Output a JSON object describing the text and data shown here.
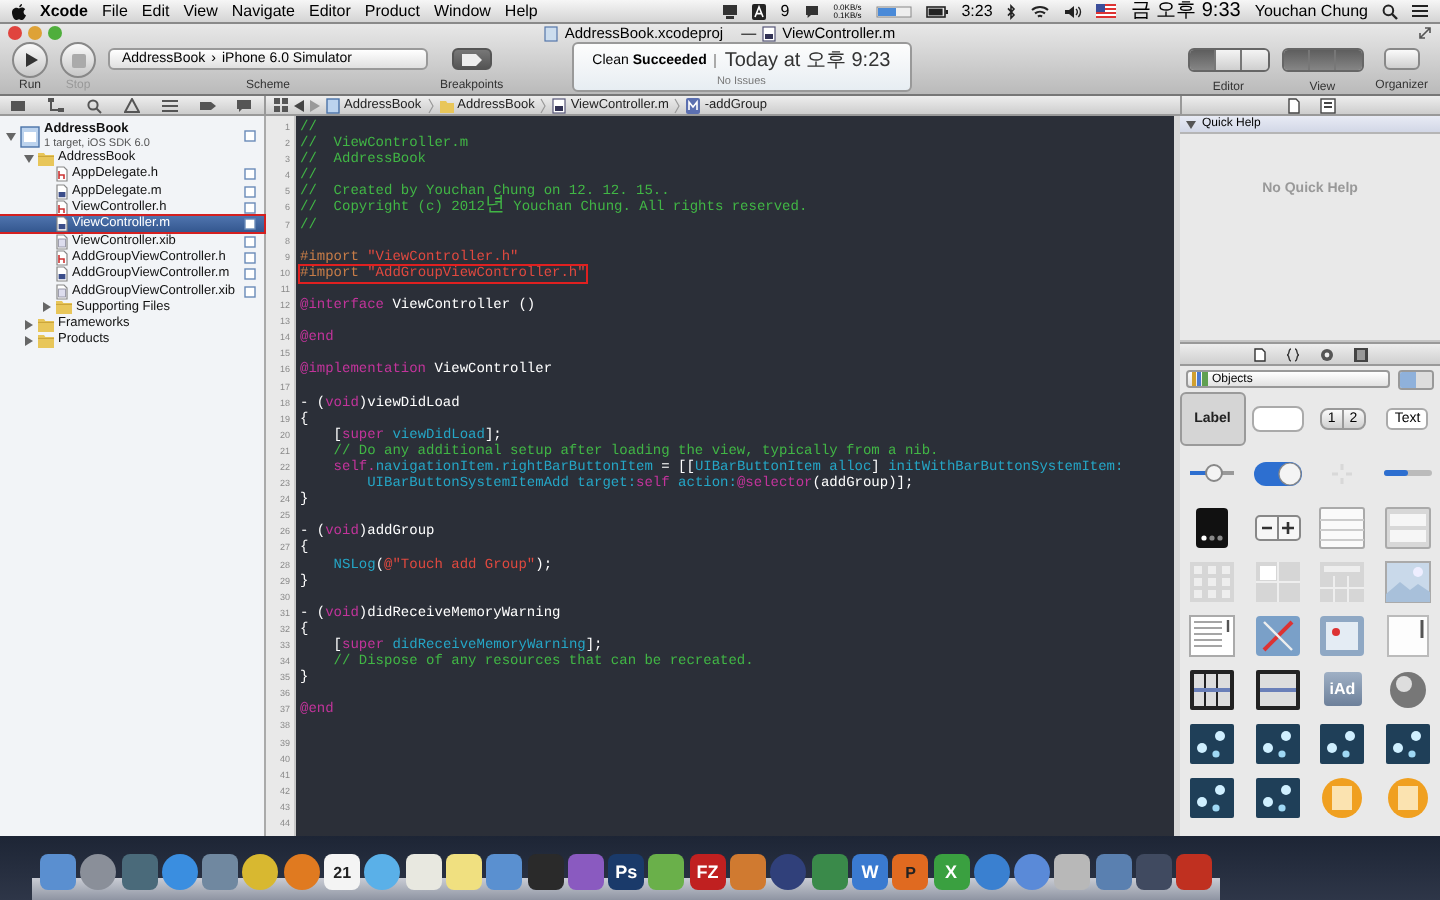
{
  "menu_bar": {
    "app": "Xcode",
    "menus": [
      "File",
      "Edit",
      "View",
      "Navigate",
      "Editor",
      "Product",
      "Window",
      "Help"
    ],
    "input_badge": "9",
    "network_up": "0.0KB/s",
    "network_down": "0.1KB/s",
    "battery": "3:23",
    "clock": "금 오후 9:33",
    "user": "Youchan Chung"
  },
  "window": {
    "project": "AddressBook.xcodeproj",
    "separator": "—",
    "file": "ViewController.m"
  },
  "toolbar": {
    "run": {
      "label": "Run",
      "disabled": false
    },
    "stop": {
      "label": "Stop",
      "disabled": true
    },
    "scheme": {
      "target": "AddressBook",
      "separator": "›",
      "destination": "iPhone 6.0 Simulator",
      "label": "Scheme"
    },
    "breakpoints": {
      "label": "Breakpoints"
    },
    "activity": {
      "status": "Clean **Succeeded**",
      "time": "Today at 오후 9:23",
      "issues": "No Issues"
    },
    "editor": {
      "label": "Editor",
      "segments": [
        {
          "selected": true
        },
        {
          "selected": false
        },
        {
          "selected": false
        }
      ]
    },
    "view": {
      "label": "View",
      "segments": [
        {
          "selected": true
        },
        {
          "selected": true
        },
        {
          "selected": true
        }
      ]
    },
    "organizer": {
      "label": "Organizer"
    }
  },
  "jump_bar": {
    "crumbs": [
      {
        "kind": "project",
        "text": "AddressBook"
      },
      {
        "kind": "folder",
        "text": "AddressBook"
      },
      {
        "kind": "source",
        "text": "ViewController.m"
      },
      {
        "kind": "method",
        "text": "-addGroup"
      }
    ]
  },
  "navigator": {
    "items": [
      {
        "kind": "project",
        "name": "AddressBook",
        "subtitle": "1 target, iOS SDK 6.0",
        "expanded": true,
        "selected": false,
        "annotated": false,
        "children": [
          {
            "kind": "group",
            "name": "AddressBook",
            "expanded": true,
            "selected": false,
            "annotated": false,
            "children": [
              {
                "kind": "header",
                "name": "AppDelegate.h",
                "selected": false,
                "annotated": false
              },
              {
                "kind": "source",
                "name": "AppDelegate.m",
                "selected": false,
                "annotated": false
              },
              {
                "kind": "header",
                "name": "ViewController.h",
                "selected": false,
                "annotated": false
              },
              {
                "kind": "source",
                "name": "ViewController.m",
                "selected": true,
                "annotated": true
              },
              {
                "kind": "xib",
                "name": "ViewController.xib",
                "selected": false,
                "annotated": false
              },
              {
                "kind": "header",
                "name": "AddGroupViewController.h",
                "selected": false,
                "annotated": false
              },
              {
                "kind": "source",
                "name": "AddGroupViewController.m",
                "selected": false,
                "annotated": false
              },
              {
                "kind": "xib",
                "name": "AddGroupViewController.xib",
                "selected": false,
                "annotated": false
              },
              {
                "kind": "group",
                "name": "Supporting Files",
                "expanded": false,
                "selected": false,
                "annotated": false
              }
            ]
          },
          {
            "kind": "group",
            "name": "Frameworks",
            "expanded": false,
            "selected": false,
            "annotated": false
          },
          {
            "kind": "group",
            "name": "Products",
            "expanded": false,
            "selected": false,
            "annotated": false
          }
        ]
      }
    ]
  },
  "editor": {
    "line_numbers": [
      "1",
      "2",
      "3",
      "4",
      "5",
      "6",
      "7",
      "8",
      "9",
      "10",
      "11",
      "12",
      "13",
      "14",
      "15",
      "16",
      "17",
      "18",
      "19",
      "20",
      "21",
      "22",
      "23",
      "24",
      "25",
      "26",
      "27",
      "28",
      "29",
      "30",
      "31",
      "32",
      "33",
      "34",
      "35",
      "36",
      "37",
      "38",
      "39",
      "40",
      "41",
      "42",
      "43",
      "44"
    ],
    "lines": [
      {
        "kind": "code",
        "tokens": [
          {
            "text": "//",
            "kind": "comment"
          }
        ],
        "annotated": false
      },
      {
        "kind": "code",
        "tokens": [
          {
            "text": "//  ViewController.m",
            "kind": "comment"
          }
        ],
        "annotated": false
      },
      {
        "kind": "code",
        "tokens": [
          {
            "text": "//  AddressBook",
            "kind": "comment"
          }
        ],
        "annotated": false
      },
      {
        "kind": "code",
        "tokens": [
          {
            "text": "//",
            "kind": "comment"
          }
        ],
        "annotated": false
      },
      {
        "kind": "code",
        "tokens": [
          {
            "text": "//  Created by Youchan Chung on 12. 12. 15..",
            "kind": "comment"
          }
        ],
        "annotated": false
      },
      {
        "kind": "code",
        "tokens": [
          {
            "text": "//  Copyright (c) 2012년 Youchan Chung. All rights reserved.",
            "kind": "comment"
          }
        ],
        "annotated": false
      },
      {
        "kind": "code",
        "tokens": [
          {
            "text": "//",
            "kind": "comment"
          }
        ],
        "annotated": false
      },
      {
        "kind": "blank"
      },
      {
        "kind": "code",
        "tokens": [
          {
            "text": "#import ",
            "kind": "preprocessor"
          },
          {
            "text": "\"ViewController.h\"",
            "kind": "string"
          }
        ],
        "annotated": false
      },
      {
        "kind": "code",
        "tokens": [
          {
            "text": "#import ",
            "kind": "preprocessor"
          },
          {
            "text": "\"AddGroupViewController.h\"",
            "kind": "string"
          }
        ],
        "annotated": true
      },
      {
        "kind": "blank"
      },
      {
        "kind": "code",
        "tokens": [
          {
            "text": "@interface",
            "kind": "keyword"
          },
          {
            "text": " ViewController ()",
            "kind": "plain"
          }
        ],
        "annotated": false
      },
      {
        "kind": "blank"
      },
      {
        "kind": "code",
        "tokens": [
          {
            "text": "@end",
            "kind": "keyword"
          }
        ],
        "annotated": false
      },
      {
        "kind": "blank"
      },
      {
        "kind": "code",
        "tokens": [
          {
            "text": "@implementation",
            "kind": "keyword"
          },
          {
            "text": " ViewController",
            "kind": "plain"
          }
        ],
        "annotated": false
      },
      {
        "kind": "blank"
      },
      {
        "kind": "code",
        "tokens": [
          {
            "text": "- (",
            "kind": "plain"
          },
          {
            "text": "void",
            "kind": "keyword"
          },
          {
            "text": ")viewDidLoad",
            "kind": "plain"
          }
        ],
        "annotated": false
      },
      {
        "kind": "code",
        "tokens": [
          {
            "text": "{",
            "kind": "plain"
          }
        ],
        "annotated": false
      },
      {
        "kind": "code",
        "tokens": [
          {
            "text": "    [",
            "kind": "plain"
          },
          {
            "text": "super ",
            "kind": "keyword"
          },
          {
            "text": "viewDidLoad",
            "kind": "api"
          },
          {
            "text": "];",
            "kind": "plain"
          }
        ],
        "annotated": false
      },
      {
        "kind": "code",
        "tokens": [
          {
            "text": "    // Do any additional setup after loading the view, typically from a nib.",
            "kind": "comment"
          }
        ],
        "annotated": false
      },
      {
        "kind": "code",
        "tokens": [
          {
            "text": "    self.",
            "kind": "keyword"
          },
          {
            "text": "navigationItem.rightBarButtonItem",
            "kind": "api"
          },
          {
            "text": " = [[",
            "kind": "plain"
          },
          {
            "text": "UIBarButtonItem alloc",
            "kind": "api"
          },
          {
            "text": "] ",
            "kind": "plain"
          },
          {
            "text": "initWithBarButtonSystemItem:",
            "kind": "api"
          }
        ],
        "annotated": false
      },
      {
        "kind": "code",
        "tokens": [
          {
            "text": "        UIBarButtonSystemItemAdd target:",
            "kind": "api"
          },
          {
            "text": "self ",
            "kind": "keyword"
          },
          {
            "text": "action:",
            "kind": "api"
          },
          {
            "text": "@selector",
            "kind": "keyword"
          },
          {
            "text": "(addGroup)];",
            "kind": "plain"
          }
        ],
        "annotated": false
      },
      {
        "kind": "code",
        "tokens": [
          {
            "text": "}",
            "kind": "plain"
          }
        ],
        "annotated": false
      },
      {
        "kind": "blank"
      },
      {
        "kind": "code",
        "tokens": [
          {
            "text": "- (",
            "kind": "plain"
          },
          {
            "text": "void",
            "kind": "keyword"
          },
          {
            "text": ")addGroup",
            "kind": "plain"
          }
        ],
        "annotated": false
      },
      {
        "kind": "code",
        "tokens": [
          {
            "text": "{",
            "kind": "plain"
          }
        ],
        "annotated": false
      },
      {
        "kind": "code",
        "tokens": [
          {
            "text": "    NSLog",
            "kind": "api"
          },
          {
            "text": "(",
            "kind": "plain"
          },
          {
            "text": "@\"Touch add Group\"",
            "kind": "string"
          },
          {
            "text": ");",
            "kind": "plain"
          }
        ],
        "annotated": false
      },
      {
        "kind": "code",
        "tokens": [
          {
            "text": "}",
            "kind": "plain"
          }
        ],
        "annotated": false
      },
      {
        "kind": "blank"
      },
      {
        "kind": "code",
        "tokens": [
          {
            "text": "- (",
            "kind": "plain"
          },
          {
            "text": "void",
            "kind": "keyword"
          },
          {
            "text": ")didReceiveMemoryWarning",
            "kind": "plain"
          }
        ],
        "annotated": false
      },
      {
        "kind": "code",
        "tokens": [
          {
            "text": "{",
            "kind": "plain"
          }
        ],
        "annotated": false
      },
      {
        "kind": "code",
        "tokens": [
          {
            "text": "    [",
            "kind": "plain"
          },
          {
            "text": "super ",
            "kind": "keyword"
          },
          {
            "text": "didReceiveMemoryWarning",
            "kind": "api"
          },
          {
            "text": "];",
            "kind": "plain"
          }
        ],
        "annotated": false
      },
      {
        "kind": "code",
        "tokens": [
          {
            "text": "    // Dispose of any resources that can be recreated.",
            "kind": "comment"
          }
        ],
        "annotated": false
      },
      {
        "kind": "code",
        "tokens": [
          {
            "text": "}",
            "kind": "plain"
          }
        ],
        "annotated": false
      },
      {
        "kind": "blank"
      },
      {
        "kind": "code",
        "tokens": [
          {
            "text": "@end",
            "kind": "keyword"
          }
        ],
        "annotated": false
      }
    ]
  },
  "inspector": {
    "quick_help": {
      "title": "Quick Help",
      "expanded": true,
      "message": "No Quick Help"
    }
  },
  "library": {
    "popup": "Objects",
    "view_modes": [
      {
        "selected": true
      },
      {
        "selected": false
      }
    ],
    "items": [
      {
        "kind": "label",
        "text": "Label",
        "selected": true
      },
      {
        "kind": "field",
        "selected": false
      },
      {
        "kind": "segmented",
        "segments": [
          "1",
          "2"
        ],
        "selected": false
      },
      {
        "kind": "text-view",
        "text": "Text",
        "selected": false
      },
      {
        "kind": "slider",
        "selected": false
      },
      {
        "kind": "switch",
        "selected": false
      },
      {
        "kind": "activity",
        "selected": false
      },
      {
        "kind": "progress",
        "selected": false
      },
      {
        "kind": "page-control",
        "selected": false
      },
      {
        "kind": "stepper",
        "selected": false
      },
      {
        "kind": "table",
        "selected": false
      },
      {
        "kind": "grouped-table",
        "selected": false
      },
      {
        "kind": "image-grid",
        "selected": false
      },
      {
        "kind": "split",
        "selected": false
      },
      {
        "kind": "collection",
        "selected": false
      },
      {
        "kind": "image",
        "selected": false
      },
      {
        "kind": "document",
        "selected": false
      },
      {
        "kind": "map",
        "selected": false
      },
      {
        "kind": "web",
        "selected": false
      },
      {
        "kind": "scroll",
        "selected": false
      },
      {
        "kind": "date-picker",
        "selected": false
      },
      {
        "kind": "picker",
        "selected": false
      },
      {
        "kind": "ad",
        "text": "iAd",
        "selected": false
      },
      {
        "kind": "sphere",
        "selected": false
      },
      {
        "kind": "particles",
        "selected": false
      },
      {
        "kind": "particles",
        "selected": false
      },
      {
        "kind": "particles",
        "selected": false
      },
      {
        "kind": "particles",
        "selected": false
      },
      {
        "kind": "particles",
        "selected": false
      },
      {
        "kind": "particles",
        "selected": false
      },
      {
        "kind": "disc",
        "selected": false
      },
      {
        "kind": "disc",
        "selected": false
      }
    ]
  },
  "dock": {
    "items": [
      {
        "kind": "square",
        "color": "#5a8fd0"
      },
      {
        "kind": "round",
        "color": "#8a8f99"
      },
      {
        "kind": "square",
        "color": "#4a6a7a"
      },
      {
        "kind": "round",
        "color": "#3a8ee0"
      },
      {
        "kind": "square",
        "color": "#7088a0"
      },
      {
        "kind": "round",
        "color": "#d8b830"
      },
      {
        "kind": "round",
        "color": "#e07a20"
      },
      {
        "kind": "square",
        "color": "#f4f4f4",
        "label": "21"
      },
      {
        "kind": "round",
        "color": "#5ab0e8"
      },
      {
        "kind": "square",
        "color": "#e8e8e0"
      },
      {
        "kind": "square",
        "color": "#f0e080"
      },
      {
        "kind": "square",
        "color": "#5a90d0"
      },
      {
        "kind": "square",
        "color": "#2a2a2a"
      },
      {
        "kind": "square",
        "color": "#8a5ac0"
      },
      {
        "kind": "square",
        "color": "#1a3a6a",
        "label": "Ps"
      },
      {
        "kind": "square",
        "color": "#6ab04a"
      },
      {
        "kind": "square",
        "color": "#c02020",
        "label": "FZ"
      },
      {
        "kind": "square",
        "color": "#d07a30"
      },
      {
        "kind": "round",
        "color": "#30407a"
      },
      {
        "kind": "square",
        "color": "#3a8a4a"
      },
      {
        "kind": "square",
        "color": "#3a7ad0",
        "label": "W"
      },
      {
        "kind": "square",
        "color": "#e06a20",
        "label": "P"
      },
      {
        "kind": "square",
        "color": "#3aa040",
        "label": "X"
      },
      {
        "kind": "round",
        "color": "#3a80d0"
      },
      {
        "kind": "round",
        "color": "#5a8ad8"
      },
      {
        "kind": "square",
        "color": "#b8b8b8"
      },
      {
        "kind": "square",
        "color": "#5a80b0"
      },
      {
        "kind": "square",
        "color": "#404a60"
      },
      {
        "kind": "square",
        "color": "#c03020"
      }
    ]
  }
}
